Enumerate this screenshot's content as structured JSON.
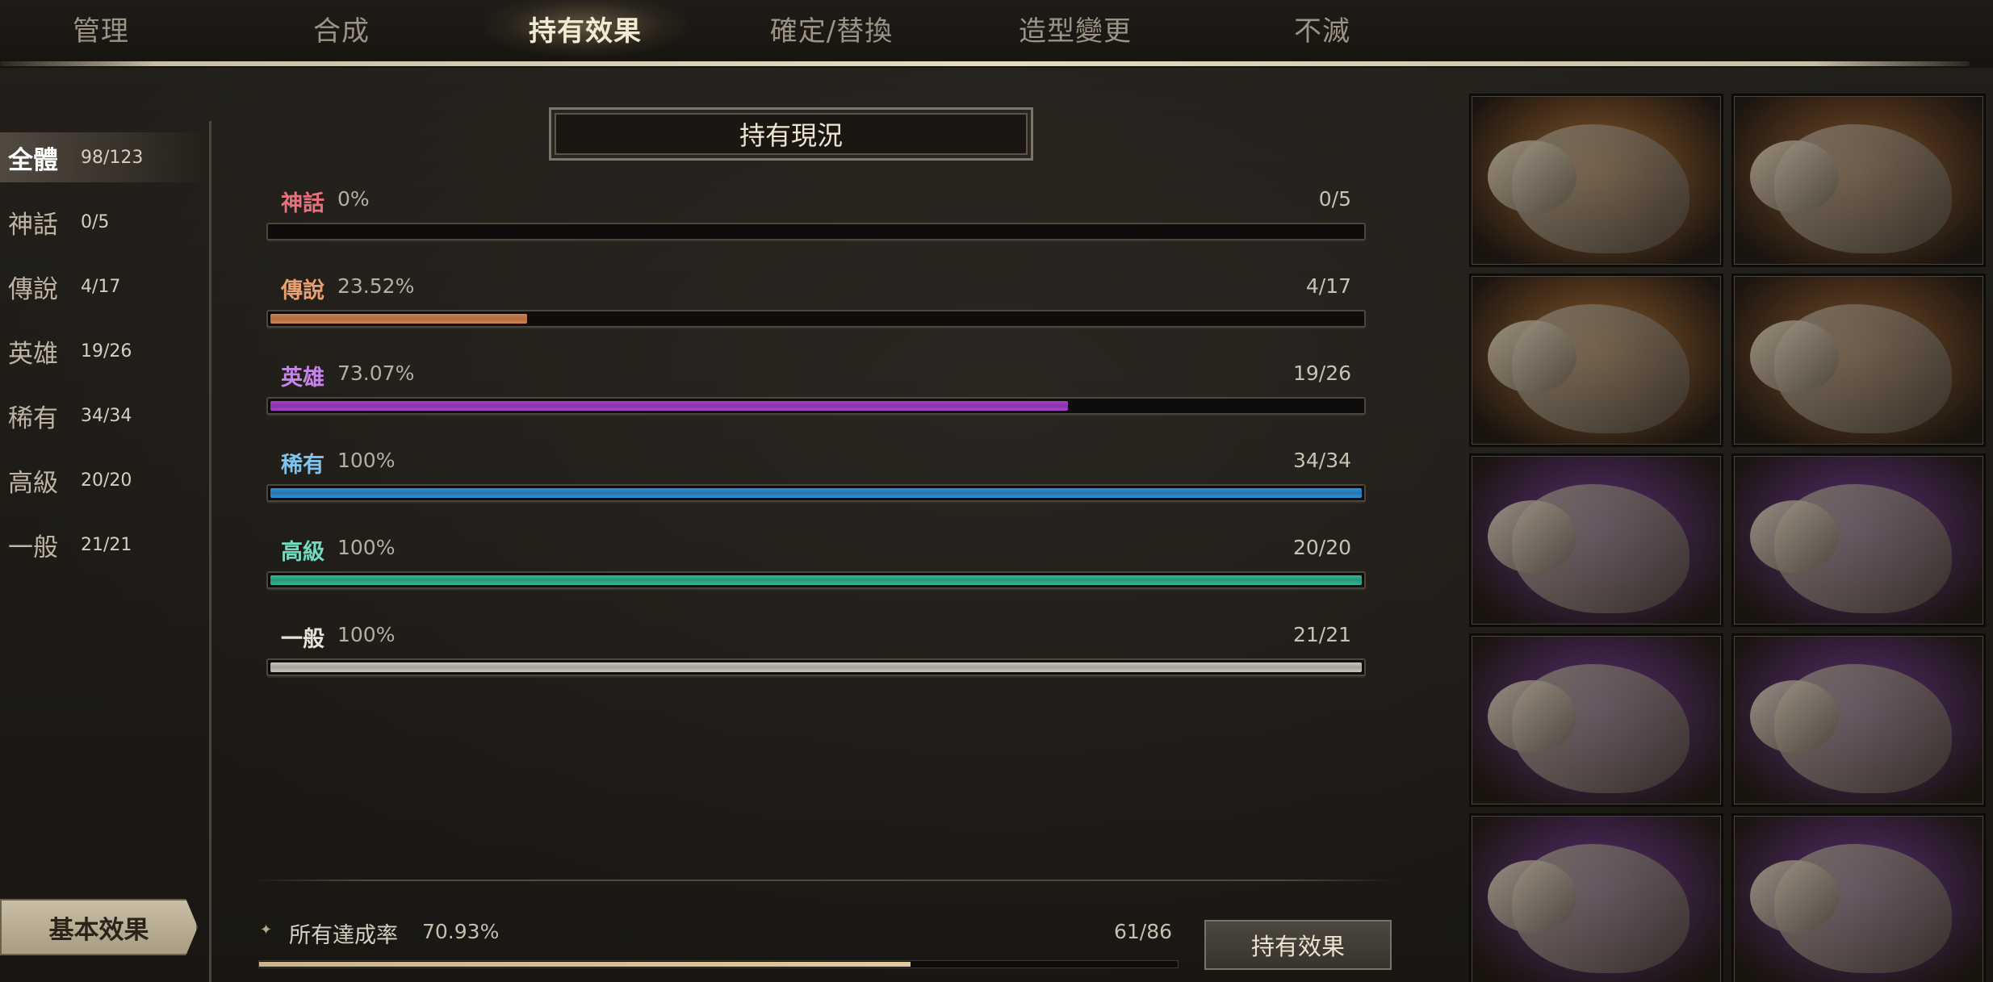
{
  "tabs": [
    {
      "label": "管理",
      "active": false
    },
    {
      "label": "合成",
      "active": false
    },
    {
      "label": "持有效果",
      "active": true
    },
    {
      "label": "確定/替換",
      "active": false
    },
    {
      "label": "造型變更",
      "active": false
    },
    {
      "label": "不滅",
      "active": false
    }
  ],
  "sidebar": {
    "items": [
      {
        "label": "全體",
        "count": "98/123",
        "active": true
      },
      {
        "label": "神話",
        "count": "0/5",
        "active": false
      },
      {
        "label": "傳說",
        "count": "4/17",
        "active": false
      },
      {
        "label": "英雄",
        "count": "19/26",
        "active": false
      },
      {
        "label": "稀有",
        "count": "34/34",
        "active": false
      },
      {
        "label": "高級",
        "count": "20/20",
        "active": false
      },
      {
        "label": "一般",
        "count": "21/21",
        "active": false
      }
    ],
    "basic_button": "基本效果"
  },
  "panel": {
    "title": "持有現況",
    "rows": [
      {
        "label": "神話",
        "percent": "0%",
        "count": "0/5",
        "fill": 0.0,
        "color": "#e8707a",
        "bar": "#b8585f"
      },
      {
        "label": "傳說",
        "percent": "23.52%",
        "count": "4/17",
        "fill": 0.2352,
        "color": "#e8a070",
        "bar": "#d4834e"
      },
      {
        "label": "英雄",
        "percent": "73.07%",
        "count": "19/26",
        "fill": 0.7307,
        "color": "#c784e8",
        "bar": "#a640d0"
      },
      {
        "label": "稀有",
        "percent": "100%",
        "count": "34/34",
        "fill": 1.0,
        "color": "#7fc4ee",
        "bar": "#2a8fd8"
      },
      {
        "label": "高級",
        "percent": "100%",
        "count": "20/20",
        "fill": 1.0,
        "color": "#6fdcbf",
        "bar": "#2fb893"
      },
      {
        "label": "一般",
        "percent": "100%",
        "count": "21/21",
        "fill": 1.0,
        "color": "#e6e2d8",
        "bar": "#c9c6be"
      }
    ]
  },
  "total": {
    "label": "所有達成率",
    "percent": "70.93%",
    "count": "61/86",
    "fill": 0.7093
  },
  "effect_button": "持有效果",
  "mounts": [
    {
      "name": "dark-armored-horse-icon",
      "bg": "#8a5a2a"
    },
    {
      "name": "white-armored-dragon-icon",
      "bg": "#7a4e28"
    },
    {
      "name": "white-owl-mount-icon",
      "bg": "#8a5a2a"
    },
    {
      "name": "armored-bear-icon",
      "bg": "#7a4e28"
    },
    {
      "name": "antlered-elk-icon",
      "bg": "#5a2f78"
    },
    {
      "name": "armored-boar-icon",
      "bg": "#5a2f78"
    },
    {
      "name": "armored-turtle-icon",
      "bg": "#5a2f78"
    },
    {
      "name": "zebra-mount-icon",
      "bg": "#5a2f78"
    },
    {
      "name": "pinto-horse-icon",
      "bg": "#5a2f78"
    },
    {
      "name": "white-elk-icon",
      "bg": "#5a2f78"
    }
  ]
}
